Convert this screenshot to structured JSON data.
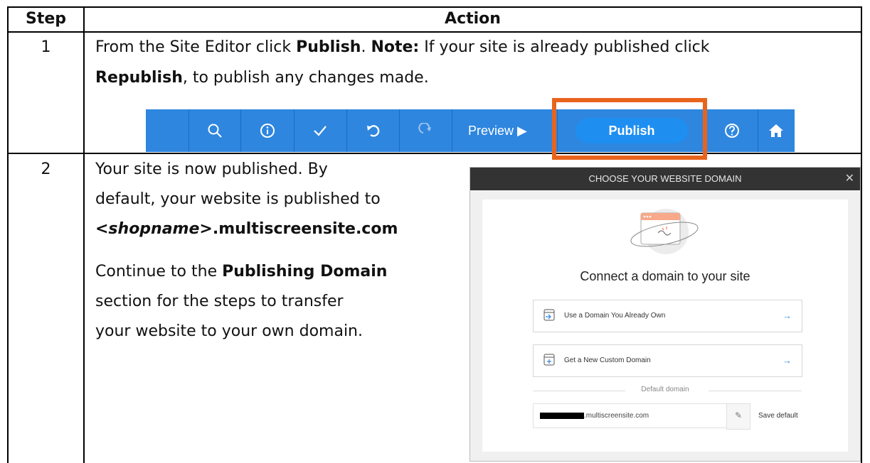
{
  "table": {
    "headers": {
      "step": "Step",
      "action": "Action"
    },
    "rows": [
      {
        "step": "1",
        "line1_a": "From the Site Editor click ",
        "line1_b": "Publish",
        "line1_c": ". ",
        "line1_d": "Note:",
        "line1_e": " If your site is already published click",
        "line2_a": "Republish",
        "line2_b": ", to publish any changes made."
      },
      {
        "step": "2",
        "p1_l1": "Your site is now published. By",
        "p1_l2": "default, your website is published to",
        "p1_l3_a": "<shopname>",
        "p1_l3_b": ".multiscreensite.com",
        "p2_l1_a": "Continue to the ",
        "p2_l1_b": "Publishing Domain",
        "p2_l2": "section for the steps to transfer",
        "p2_l3": "your website to your own domain."
      }
    ]
  },
  "toolbar": {
    "icons": [
      "search-icon",
      "info-icon",
      "checkmark-icon",
      "undo-icon",
      "redo-icon",
      "help-icon",
      "home-icon"
    ],
    "preview_label": "Preview ▶",
    "publish_label": "Publish",
    "background_color": "#2e86df",
    "highlight_color": "#e8641d"
  },
  "dialog": {
    "title": "CHOOSE YOUR WEBSITE DOMAIN",
    "close": "✕",
    "heading": "Connect a domain to your site",
    "options": [
      {
        "label": "Use a Domain You Already Own",
        "arrow": "→",
        "icon": "domain-import-icon"
      },
      {
        "label": "Get a New Custom Domain",
        "arrow": "→",
        "icon": "domain-add-icon"
      }
    ],
    "default_label": "Default domain",
    "default_domain_suffix": ".multiscreensite.com",
    "save_default": "Save default"
  }
}
